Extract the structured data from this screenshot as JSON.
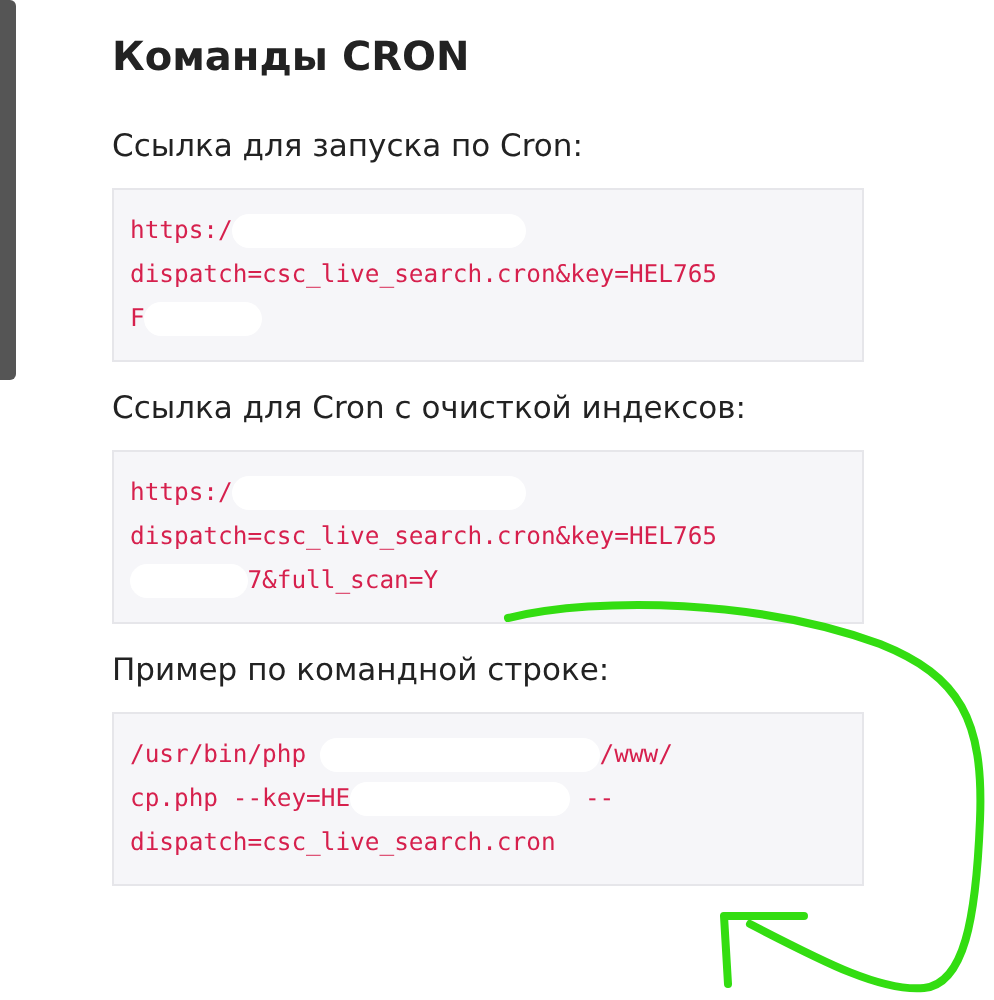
{
  "heading": "Команды CRON",
  "sections": [
    {
      "label": "Ссылка для запуска по Cron:",
      "lines": [
        [
          {
            "kind": "text",
            "text": "https:/"
          },
          {
            "kind": "redaction"
          }
        ],
        [
          {
            "kind": "text",
            "text": "dispatch=csc_live_search.cron&key=HEL765"
          }
        ],
        [
          {
            "kind": "text",
            "text": "F"
          },
          {
            "kind": "redaction"
          }
        ]
      ]
    },
    {
      "label": "Ссылка для Cron с очисткой индексов:",
      "lines": [
        [
          {
            "kind": "text",
            "text": "https:/"
          },
          {
            "kind": "redaction"
          }
        ],
        [
          {
            "kind": "text",
            "text": "dispatch=csc_live_search.cron&key=HEL765"
          }
        ],
        [
          {
            "kind": "redaction"
          },
          {
            "kind": "text",
            "text": "7&full_scan=Y"
          }
        ]
      ]
    },
    {
      "label": "Пример по командной строке:",
      "lines": [
        [
          {
            "kind": "text",
            "text": "/usr/bin/php "
          },
          {
            "kind": "redaction"
          },
          {
            "kind": "text",
            "text": "/www/"
          }
        ],
        [
          {
            "kind": "text",
            "text": "cp.php --key=HE"
          },
          {
            "kind": "redaction"
          },
          {
            "kind": "text",
            "text": " --"
          }
        ],
        [
          {
            "kind": "text",
            "text": "dispatch=csc_live_search.cron"
          }
        ]
      ]
    }
  ],
  "annotation": {
    "kind": "arrow"
  }
}
